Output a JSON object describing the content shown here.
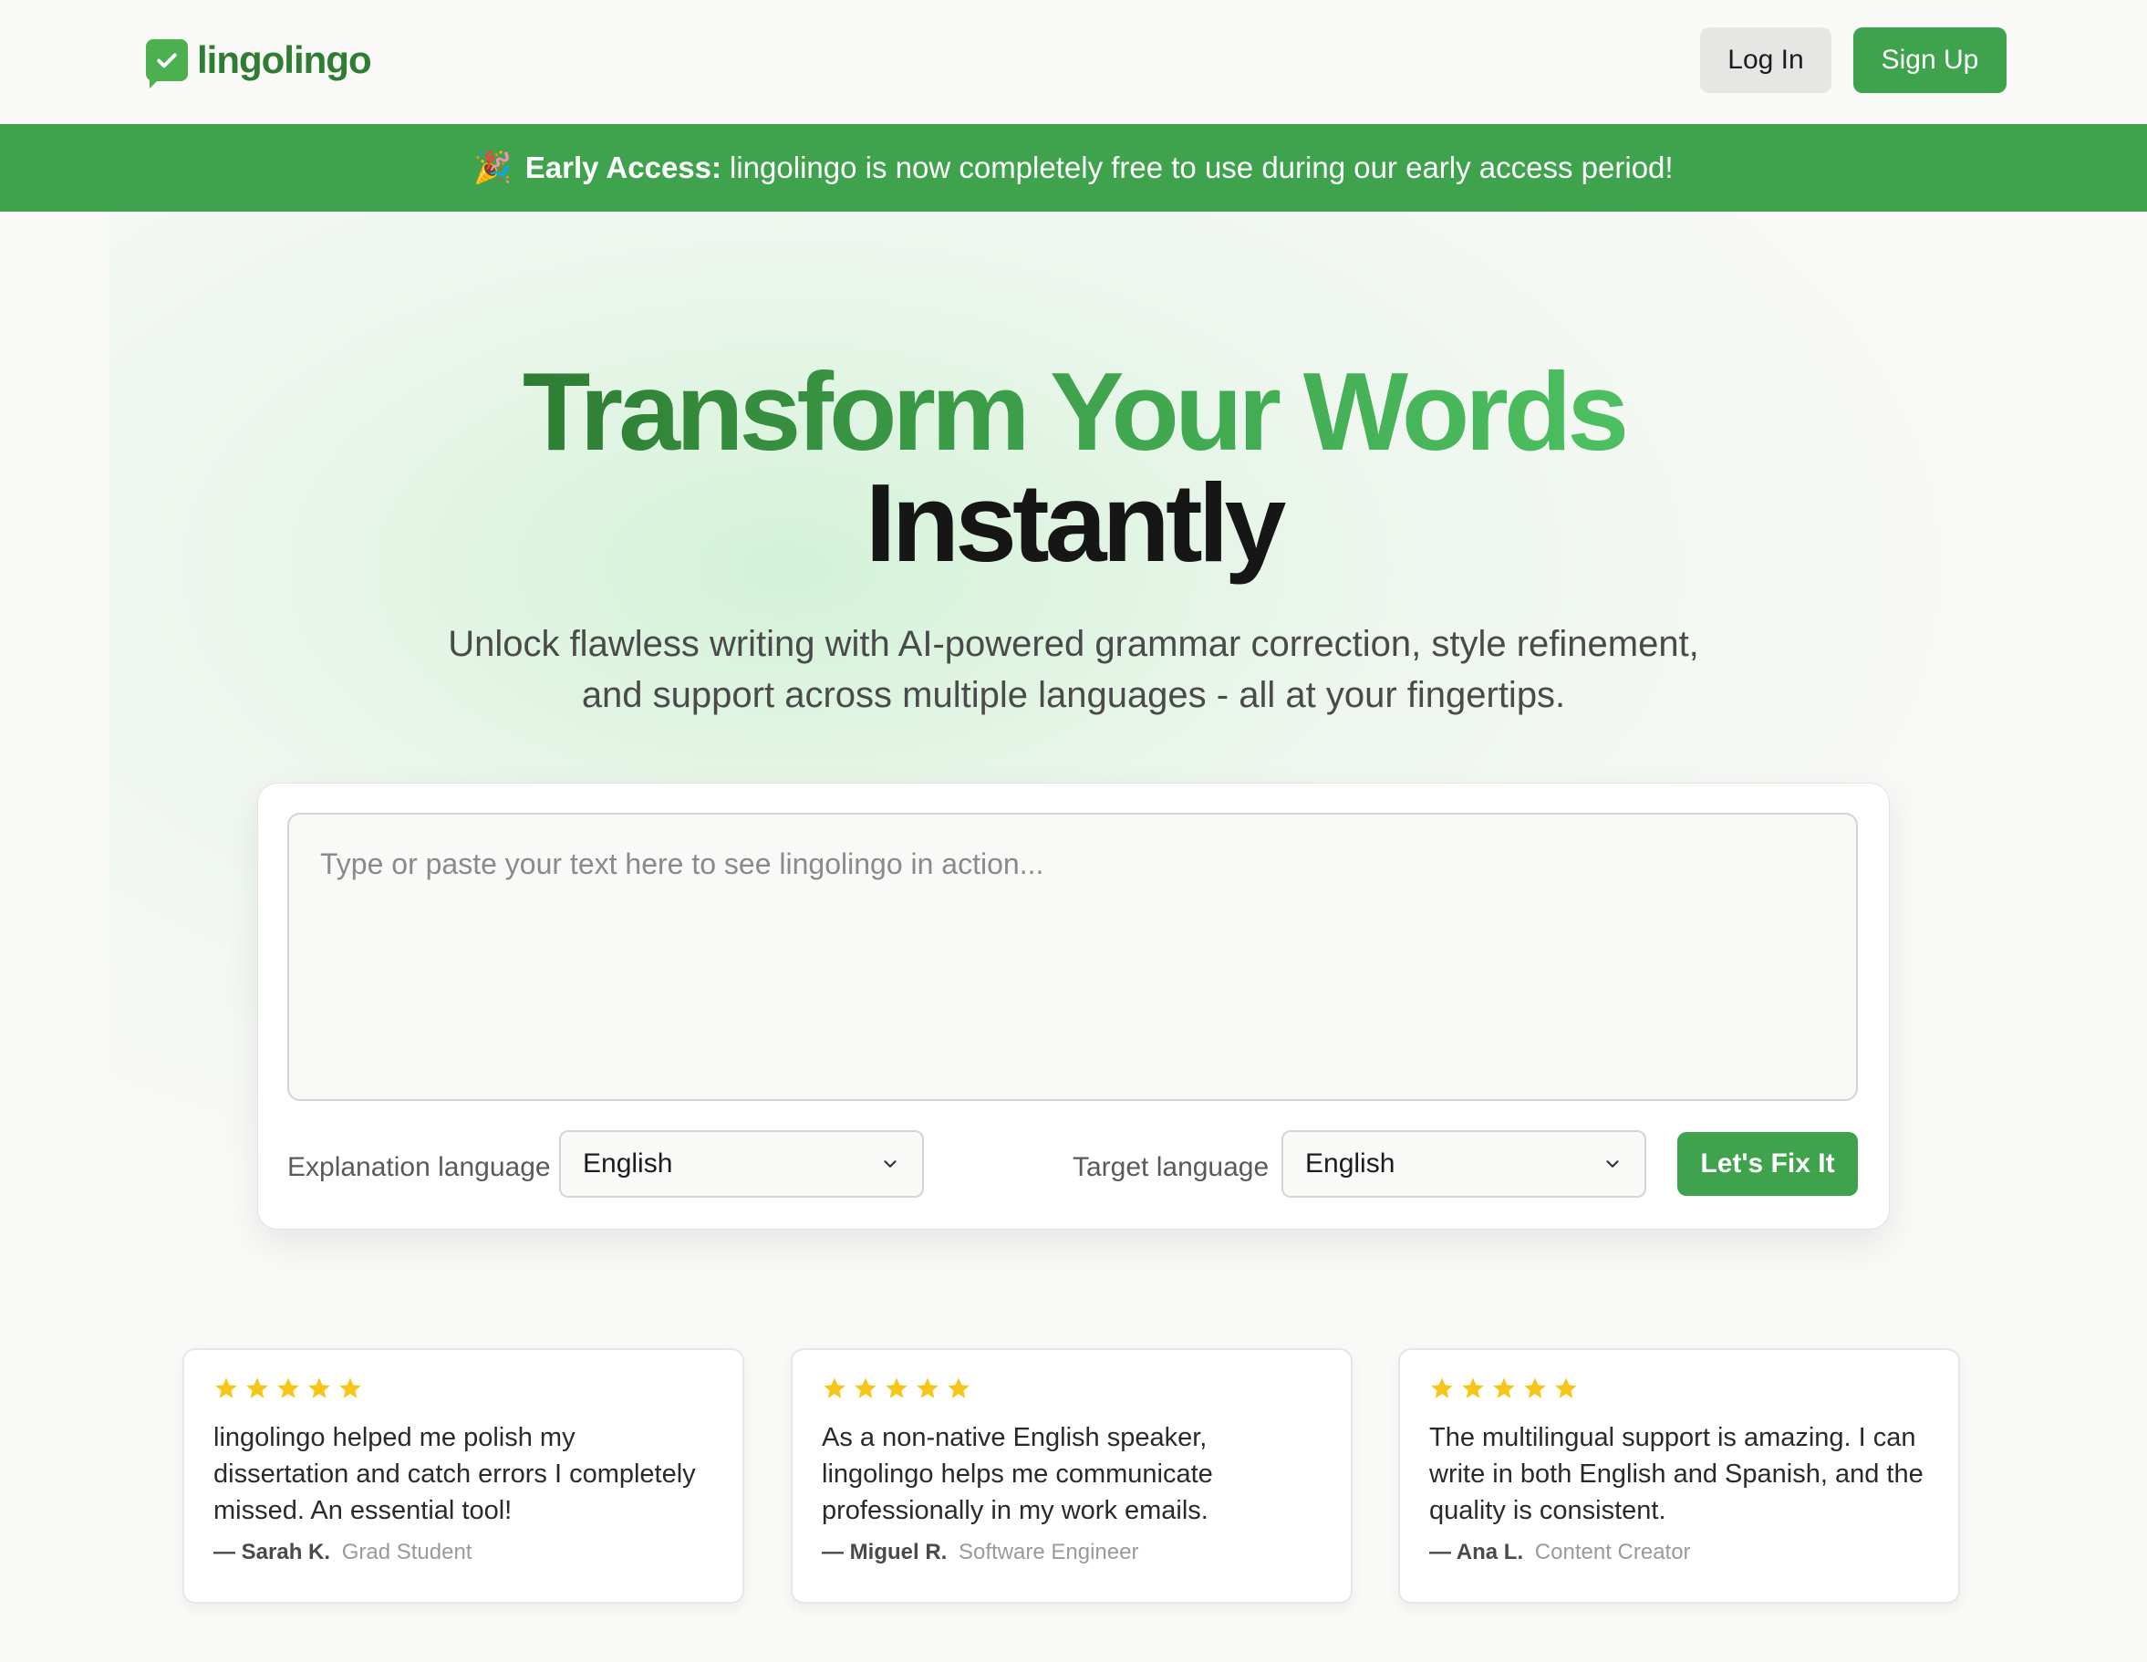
{
  "brand": {
    "name": "lingolingo",
    "accent": "#3fa34d",
    "dark_accent": "#2e7d32"
  },
  "header": {
    "login_label": "Log In",
    "signup_label": "Sign Up"
  },
  "banner": {
    "icon": "party-popper-icon",
    "bold": "Early Access:",
    "text": "lingolingo is now completely free to use during our early access period!"
  },
  "hero": {
    "title_line1": "Transform Your Words",
    "title_line2": "Instantly",
    "subtitle": "Unlock flawless writing with AI-powered grammar correction, style refinement, and support across multiple languages - all at your fingertips."
  },
  "editor": {
    "placeholder": "Type or paste your text here to see lingolingo in action...",
    "value": "",
    "explanation_label": "Explanation language",
    "explanation_value": "English",
    "target_label": "Target language",
    "target_value": "English",
    "submit_label": "Let's Fix It"
  },
  "testimonials": [
    {
      "rating": 5,
      "quote": "lingolingo helped me polish my dissertation and catch errors I completely missed. An essential tool!",
      "name": "— Sarah K.",
      "role": "Grad Student"
    },
    {
      "rating": 5,
      "quote": "As a non-native English speaker, lingolingo helps me communicate professionally in my work emails.",
      "name": "— Miguel R.",
      "role": "Software Engineer"
    },
    {
      "rating": 5,
      "quote": "The multilingual support is amazing. I can write in both English and Spanish, and the quality is consistent.",
      "name": "— Ana L.",
      "role": "Content Creator"
    }
  ],
  "star_color": "#f5c518"
}
